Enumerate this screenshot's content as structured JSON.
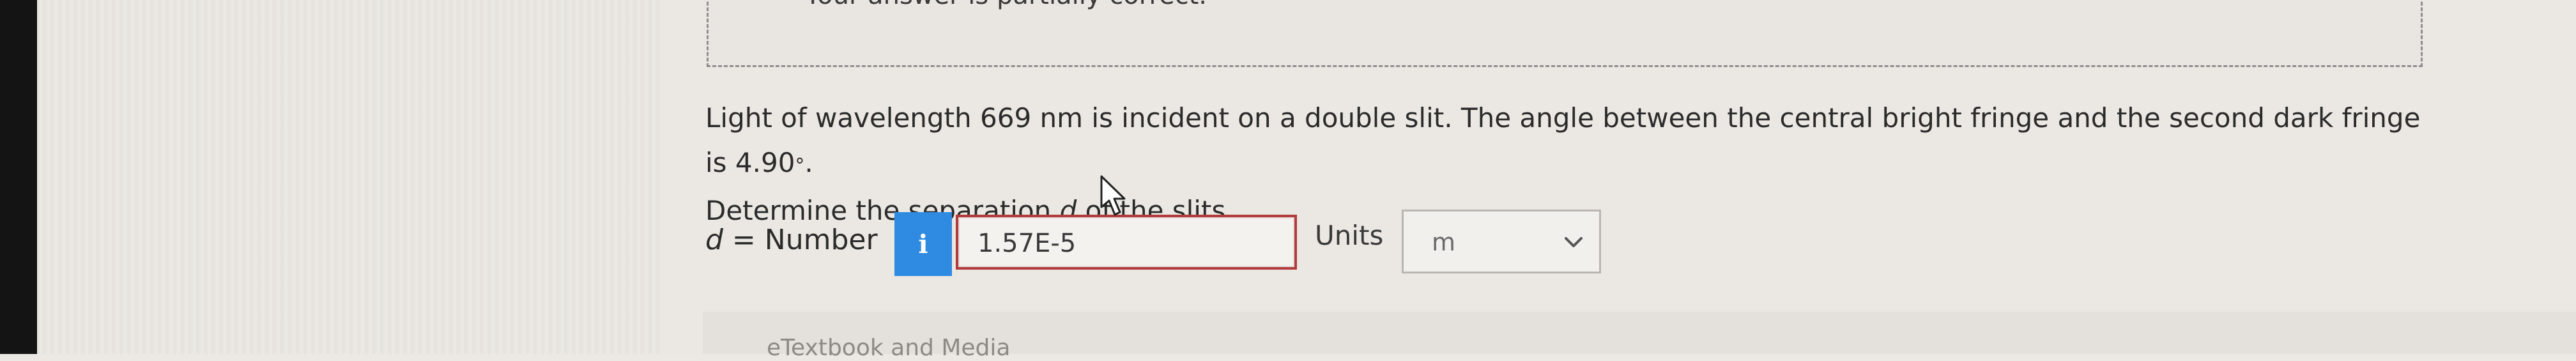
{
  "feedback": {
    "text": "Your answer is partially correct."
  },
  "question": {
    "line1_part1": "Light of wavelength 669 nm is incident on a double slit. The angle between the central bright fringe and the second dark fringe is 4.90",
    "degree_symbol": "°",
    "line1_end": ".",
    "line2_part1": "Determine the separation ",
    "line2_var": "d",
    "line2_part2": " of the slits."
  },
  "answer": {
    "var": "d",
    "label_rest": " = Number",
    "info_glyph": "i",
    "value": "1.57E-5",
    "units_label": "Units",
    "units_value": "m"
  },
  "icons": {
    "info": "info-icon",
    "dropdown": "chevron-down-icon",
    "cursor": "mouse-pointer-icon"
  },
  "colors": {
    "accent": "#2f8be2",
    "error_border": "#b23b3b"
  },
  "footer": {
    "partial_text": "eTextbook and Media"
  }
}
